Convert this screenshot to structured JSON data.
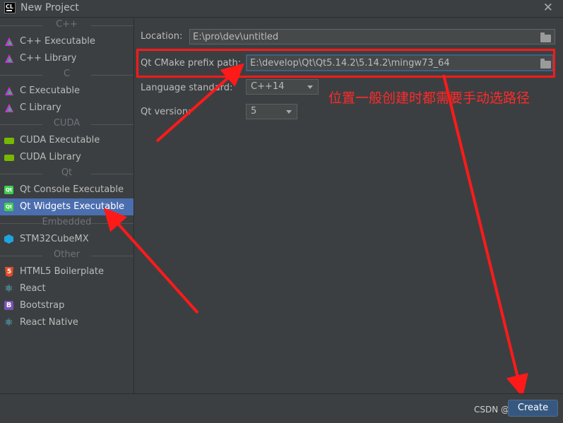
{
  "window": {
    "icon_label": "CL",
    "title": "New Project",
    "close_label": "✕"
  },
  "sidebar": {
    "groups": [
      {
        "header": "C++",
        "items": [
          {
            "label": "C++ Executable",
            "icon": "cmake-icon"
          },
          {
            "label": "C++ Library",
            "icon": "cmake-icon"
          }
        ]
      },
      {
        "header": "C",
        "items": [
          {
            "label": "C Executable",
            "icon": "cmake-icon"
          },
          {
            "label": "C Library",
            "icon": "cmake-icon"
          }
        ]
      },
      {
        "header": "CUDA",
        "items": [
          {
            "label": "CUDA Executable",
            "icon": "nvidia-icon"
          },
          {
            "label": "CUDA Library",
            "icon": "nvidia-icon"
          }
        ]
      },
      {
        "header": "Qt",
        "items": [
          {
            "label": "Qt Console Executable",
            "icon": "qt-icon"
          },
          {
            "label": "Qt Widgets Executable",
            "icon": "qt-icon",
            "selected": true
          }
        ]
      },
      {
        "header": "Embedded",
        "items": [
          {
            "label": "STM32CubeMX",
            "icon": "stm32-cube-icon"
          }
        ]
      },
      {
        "header": "Other",
        "items": [
          {
            "label": "HTML5 Boilerplate",
            "icon": "html5-icon"
          },
          {
            "label": "React",
            "icon": "react-icon"
          },
          {
            "label": "Bootstrap",
            "icon": "bootstrap-icon"
          },
          {
            "label": "React Native",
            "icon": "react-icon"
          }
        ]
      }
    ],
    "selected_color": "#4b6eaf"
  },
  "form": {
    "location_label": "Location:",
    "location_value": "E:\\pro\\dev\\untitled",
    "qt_prefix_label": "Qt CMake prefix path:",
    "qt_prefix_value": "E:\\develop\\Qt\\Qt5.14.2\\5.14.2\\mingw73_64",
    "language_label": "Language standard:",
    "language_value": "C++14",
    "qt_version_label": "Qt version:",
    "qt_version_value": "5"
  },
  "annotation": {
    "text": "位置一般创建时都需要手动选路径",
    "color": "#ff1a1a"
  },
  "footer": {
    "create_label": "Create",
    "watermark": "CSDN @KeyuRee"
  },
  "colors": {
    "background": "#3c3f41",
    "accent": "#365880",
    "field_focus": "#3d6185"
  }
}
